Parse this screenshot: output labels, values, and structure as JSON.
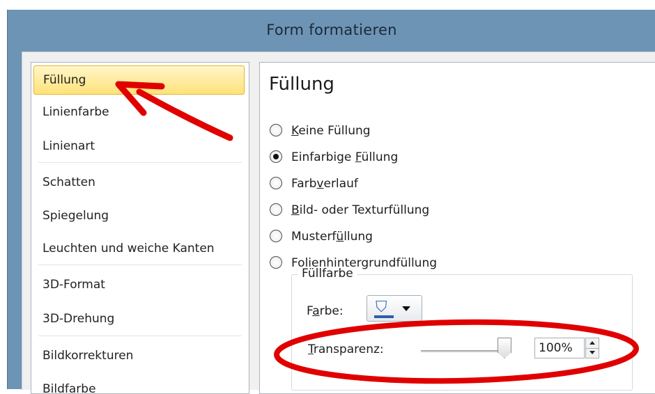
{
  "window": {
    "title": "Form formatieren"
  },
  "sidebar": {
    "items": [
      {
        "label": "Füllung"
      },
      {
        "label": "Linienfarbe"
      },
      {
        "label": "Linienart"
      },
      {
        "label": "Schatten"
      },
      {
        "label": "Spiegelung"
      },
      {
        "label": "Leuchten und weiche Kanten"
      },
      {
        "label": "3D-Format"
      },
      {
        "label": "3D-Drehung"
      },
      {
        "label": "Bildkorrekturen"
      },
      {
        "label": "Bildfarbe"
      }
    ],
    "selected_index": 0
  },
  "panel": {
    "title": "Füllung",
    "fill_options": [
      {
        "pre": "",
        "key": "K",
        "post": "eine Füllung",
        "selected": false
      },
      {
        "pre": "Einfarbige ",
        "key": "F",
        "post": "üllung",
        "selected": true
      },
      {
        "pre": "Farb",
        "key": "v",
        "post": "erlauf",
        "selected": false
      },
      {
        "pre": "",
        "key": "B",
        "post": "ild- oder Texturfüllung",
        "selected": false
      },
      {
        "pre": "Musterf",
        "key": "ü",
        "post": "llung",
        "selected": false
      },
      {
        "pre": "Folie",
        "key": "n",
        "post": "hintergrundfüllung",
        "selected": false
      }
    ],
    "fill_color_group": {
      "legend": "Füllfarbe",
      "color_label_pre": "F",
      "color_label_key": "a",
      "color_label_post": "rbe:",
      "color_icon": "paint-bucket-icon",
      "color_swatch": "#2f5ea8",
      "transparency_label_key": "T",
      "transparency_label_post": "ransparenz:",
      "transparency_value": "100%",
      "transparency_level": 1.0
    }
  },
  "annotations": {
    "arrow_color": "#e00000",
    "ellipse_color": "#e00000"
  },
  "colors": {
    "titlebar": "#6e94b5",
    "selected_item": "#ffe27a"
  }
}
